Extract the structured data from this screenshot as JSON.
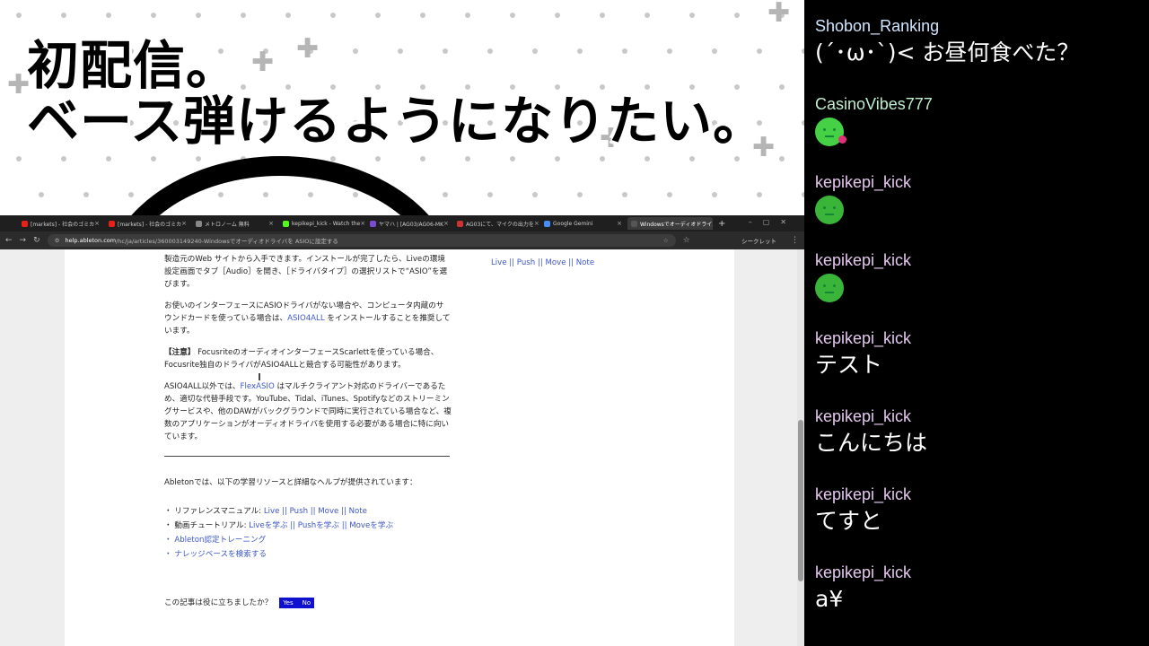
{
  "banner": {
    "title_line1": "初配信。",
    "title_line2": "ベース弾けるようになりたい。"
  },
  "browser": {
    "tabs": [
      {
        "label": "[markets] - 社会のゴミカ",
        "icon": "youtube-icon"
      },
      {
        "label": "[markets] - 社会のゴミカ",
        "icon": "youtube-icon"
      },
      {
        "label": "メトロノーム 無料",
        "icon": "page-icon"
      },
      {
        "label": "kepikepi_kick - Watch the",
        "icon": "kick-icon"
      },
      {
        "label": "ヤマハ | [AG03/AG06-MK",
        "icon": "page-icon"
      },
      {
        "label": "AG03にて、マイクの出力を",
        "icon": "page-icon"
      },
      {
        "label": "Google Gemini",
        "icon": "gemini-icon"
      },
      {
        "label": "WindowsでオーディオドライバをA",
        "icon": "page-icon",
        "active": true
      }
    ],
    "new_tab": "+",
    "url_host": "help.ableton.com",
    "url_path": "/hc/ja/articles/360003149240-Windowsでオーディオドライバを ASIOに設定する",
    "incognito_label": "シークレット"
  },
  "article": {
    "p1": "製造元のWeb サイトから入手できます。インストールが完了したら、Liveの環境設定画面でタブ［Audio］を開き、［ドライバタイプ］の選択リストで“ASIO”を選びます。",
    "p2_pre": "お使いのインターフェースにASIOドライバがない場合や、コンピュータ内蔵のサウンドカードを使っている場合は、",
    "p2_link": "ASIO4ALL",
    "p2_post": " をインストールすることを推奨しています。",
    "p3_head": "【注意】",
    "p3_body": " FocusriteのオーディオインターフェースScarlettを使っている場合、Focusrite独自のドライバがASIO4ALLと競合する可能性があります。",
    "p4_pre": "ASIO4ALL以外では、",
    "p4_link": "FlexASIO",
    "p4_post": " はマルチクライアント対応のドライバーであるため、適切な代替手段です。YouTube、Tidal、iTunes、Spotifyなどのストリーミングサービスや、他のDAWがバックグラウンドで同時に実行されている場合など、複数のアプリケーションがオーディオドライバを使用する必要がある場合に特に向いています。",
    "p5": "Abletonでは、以下の学習リソースと詳細なヘルプが提供されています：",
    "res1_label": "・ リファレンスマニュアル:",
    "res1_links": "Live || Push || Move || Note",
    "res2_label": "・ 動画チュートリアル:",
    "res2_links": "Liveを学ぶ || Pushを学ぶ || Moveを学ぶ",
    "res3": "・ Ableton認定トレーニング",
    "res4": "・ ナレッジベースを検索する",
    "feedback_q": "この記事は役に立ちましたか？",
    "yes": "Yes",
    "no": "No",
    "side_links": "Live || Push || Move || Note"
  },
  "chat": [
    {
      "user": "Shobon_Ranking",
      "text": "(´･ω･`)< お昼何食べた？"
    },
    {
      "user": "CasinoVibes777",
      "emote": "green-character-emote"
    },
    {
      "user": "kepikepi_kick",
      "emote": "green-blob-emote"
    },
    {
      "user": "kepikepi_kick",
      "emote": "green-blob-emote"
    },
    {
      "user": "kepikepi_kick",
      "text": "テスト"
    },
    {
      "user": "kepikepi_kick",
      "text": "こんにちは"
    },
    {
      "user": "kepikepi_kick",
      "text": "てすと"
    },
    {
      "user": "kepikepi_kick",
      "text": "a¥"
    }
  ]
}
